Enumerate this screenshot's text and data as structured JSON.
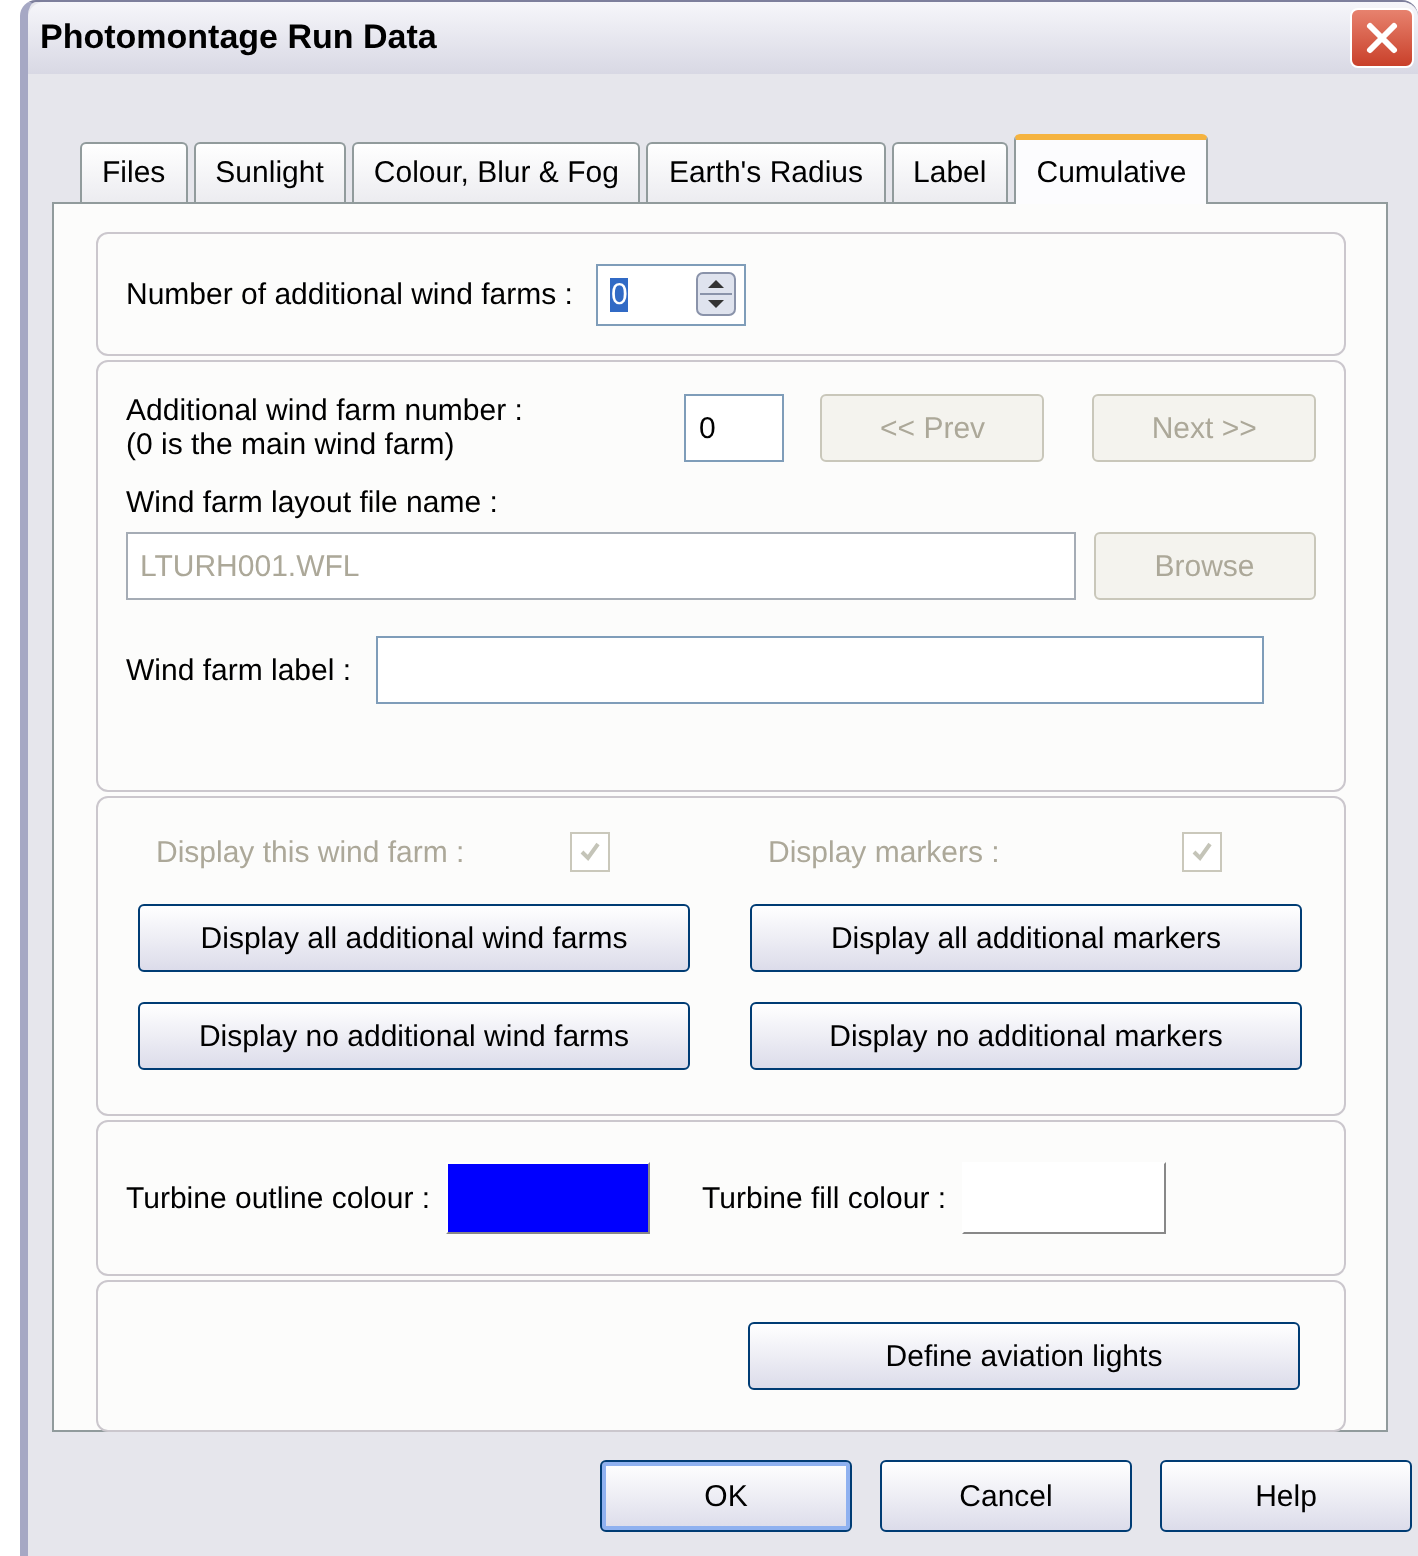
{
  "window": {
    "title": "Photomontage Run Data"
  },
  "tabs": [
    {
      "label": "Files",
      "selected": false
    },
    {
      "label": "Sunlight",
      "selected": false
    },
    {
      "label": "Colour, Blur & Fog",
      "selected": false
    },
    {
      "label": "Earth's Radius",
      "selected": false
    },
    {
      "label": "Label",
      "selected": false
    },
    {
      "label": "Cumulative",
      "selected": true
    }
  ],
  "wind_farm_count": {
    "label": "Number of additional wind farms :",
    "value": "0"
  },
  "farm": {
    "number_label": "Additional wind farm number :",
    "number_note": "(0 is the main wind farm)",
    "number_value": "0",
    "prev_button": {
      "label": "<< Prev",
      "disabled": true
    },
    "next_button": {
      "label": "Next >>",
      "disabled": true
    },
    "file_label": "Wind farm layout file name :",
    "file_field": {
      "value": "LTURH001.WFL",
      "disabled": true
    },
    "browse_button": {
      "label": "Browse",
      "disabled": true
    },
    "label_label": "Wind farm label :"
  },
  "display": {
    "checks": [
      {
        "label": "Display this wind farm :",
        "checked": true,
        "disabled": true
      },
      {
        "label": "Display markers :",
        "checked": true,
        "disabled": true
      }
    ],
    "buttons": [
      "Display all additional wind farms",
      "Display all additional markers",
      "Display no additional wind farms",
      "Display no additional markers"
    ]
  },
  "colours": [
    {
      "label": "Turbine outline colour :",
      "color": "#0000ff"
    },
    {
      "label": "Turbine fill colour :",
      "color": "#ffffff"
    }
  ],
  "aviation_button": "Define aviation lights",
  "buttons": [
    {
      "label": "OK",
      "default": true
    },
    {
      "label": "Cancel",
      "default": false
    },
    {
      "label": "Help",
      "default": false
    }
  ]
}
